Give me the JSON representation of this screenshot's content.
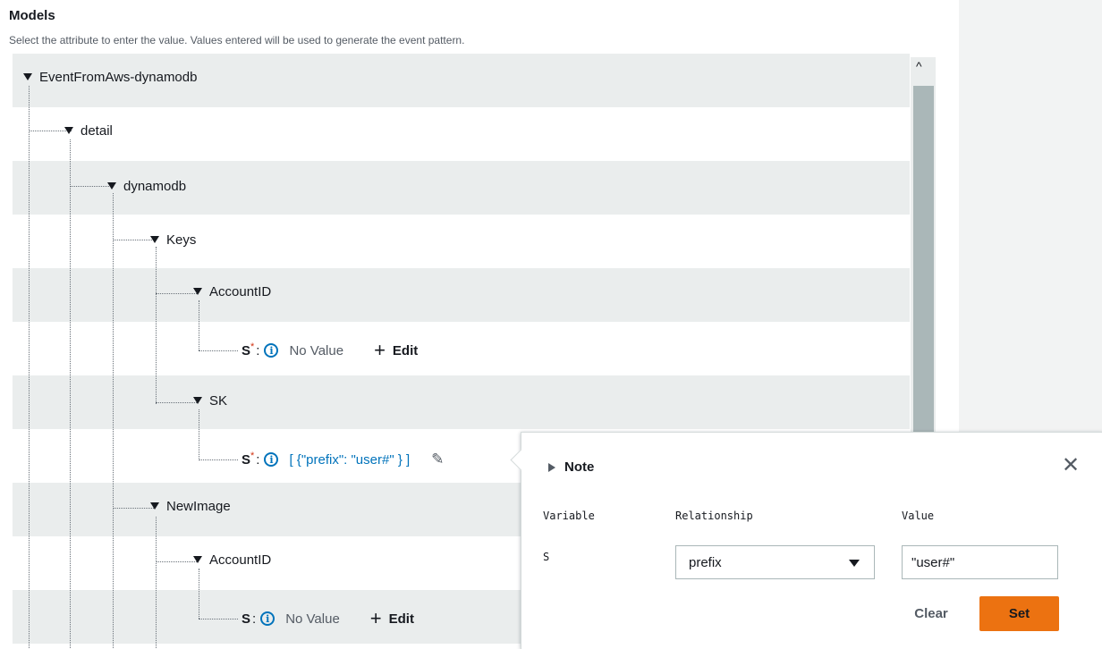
{
  "header": {
    "title": "Models",
    "description": "Select the attribute to enter the value. Values entered will be used to generate the event pattern."
  },
  "tree": {
    "root": "EventFromAws-dynamodb",
    "detail": "detail",
    "dynamodb": "dynamodb",
    "keys": "Keys",
    "keys_accountid": "AccountID",
    "keys_accountid_s": {
      "name": "S",
      "required": "*",
      "colon": ":",
      "value": "No Value",
      "edit": "Edit"
    },
    "sk": "SK",
    "sk_s": {
      "name": "S",
      "required": "*",
      "colon": ":",
      "value": "[ {\"prefix\": \"user#\" } ]"
    },
    "newimage": "NewImage",
    "newimage_accountid": "AccountID",
    "newimage_accountid_s": {
      "name": "S",
      "colon": ":",
      "value": "No Value",
      "edit": "Edit"
    }
  },
  "popover": {
    "note_label": "Note",
    "variable_header": "Variable",
    "relationship_header": "Relationship",
    "value_header": "Value",
    "variable": "S",
    "relationship_selected": "prefix",
    "value": "\"user#\"",
    "clear_label": "Clear",
    "set_label": "Set"
  },
  "icons": {
    "info": "info-icon",
    "edit": "plus-icon",
    "pencil": "pencil-icon",
    "close": "close-icon"
  },
  "colors": {
    "link": "#0073bb",
    "required": "#d13212",
    "primary_button": "#ec7211",
    "row_alt": "#eaeded"
  }
}
